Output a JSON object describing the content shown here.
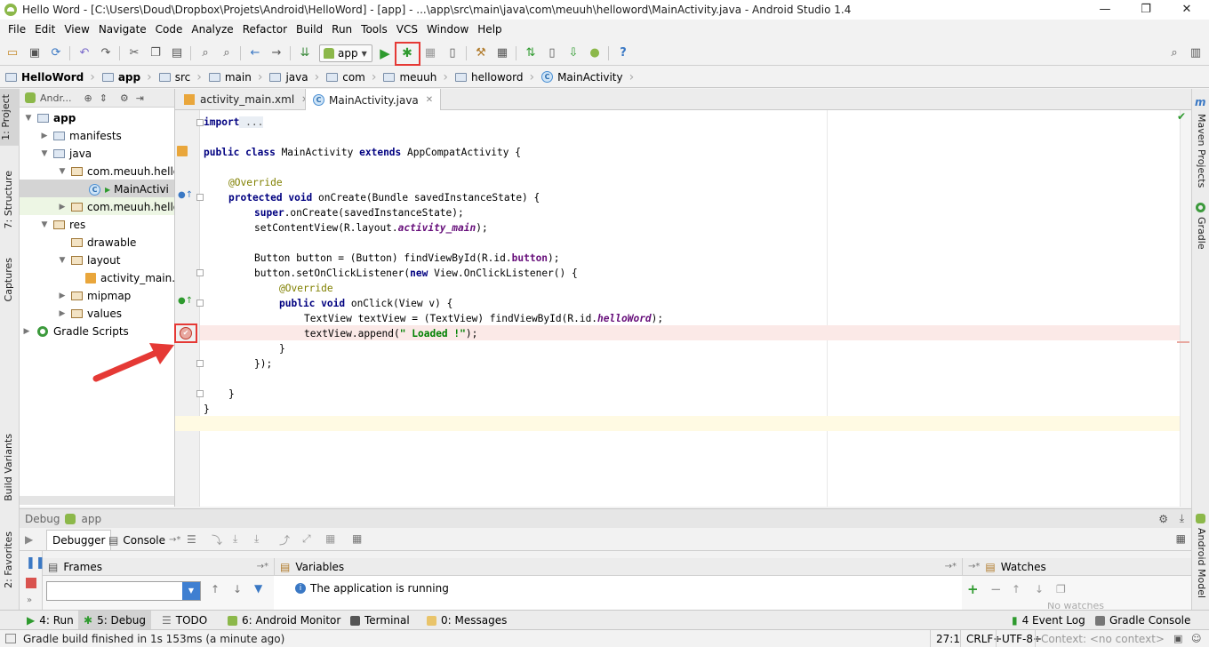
{
  "window": {
    "title": "Hello Word - [C:\\Users\\Doud\\Dropbox\\Projets\\Android\\HelloWord] - [app] - ...\\app\\src\\main\\java\\com\\meuuh\\helloword\\MainActivity.java - Android Studio 1.4",
    "minimize": "—",
    "maximize": "❐",
    "close": "✕"
  },
  "menu": [
    "File",
    "Edit",
    "View",
    "Navigate",
    "Code",
    "Analyze",
    "Refactor",
    "Build",
    "Run",
    "Tools",
    "VCS",
    "Window",
    "Help"
  ],
  "toolbar": {
    "run_config": "app"
  },
  "breadcrumb": [
    "HelloWord",
    "app",
    "src",
    "main",
    "java",
    "com",
    "meuuh",
    "helloword",
    "MainActivity"
  ],
  "left_tabs": [
    "1: Project",
    "7: Structure",
    "Captures",
    "Build Variants",
    "2: Favorites"
  ],
  "right_tabs": [
    "Maven Projects",
    "Gradle",
    "Android Model"
  ],
  "project": {
    "view_label": "Andr...",
    "tree": [
      {
        "label": "app",
        "depth": 0,
        "kind": "folder",
        "expanded": true
      },
      {
        "label": "manifests",
        "depth": 1,
        "kind": "folder",
        "expanded": false
      },
      {
        "label": "java",
        "depth": 1,
        "kind": "folder",
        "expanded": true
      },
      {
        "label": "com.meuuh.hello",
        "depth": 2,
        "kind": "folder",
        "expanded": true
      },
      {
        "label": "MainActivi",
        "depth": 3,
        "kind": "class",
        "selected": true
      },
      {
        "label": "com.meuuh.hello",
        "depth": 2,
        "kind": "folder",
        "expanded": false
      },
      {
        "label": "res",
        "depth": 1,
        "kind": "res",
        "expanded": true
      },
      {
        "label": "drawable",
        "depth": 2,
        "kind": "res",
        "expanded": null
      },
      {
        "label": "layout",
        "depth": 2,
        "kind": "res",
        "expanded": true
      },
      {
        "label": "activity_main.",
        "depth": 3,
        "kind": "xml"
      },
      {
        "label": "mipmap",
        "depth": 2,
        "kind": "res",
        "expanded": false
      },
      {
        "label": "values",
        "depth": 2,
        "kind": "res",
        "expanded": false
      },
      {
        "label": "Gradle Scripts",
        "depth": 0,
        "kind": "gradle",
        "expanded": false
      }
    ]
  },
  "editor": {
    "tabs": [
      {
        "label": "activity_main.xml",
        "active": false
      },
      {
        "label": "MainActivity.java",
        "active": true
      }
    ],
    "code": {
      "l1_kw": "import",
      "l1_fold": " ...",
      "l3_kw1": "public class ",
      "l3_name": "MainActivity ",
      "l3_kw2": "extends ",
      "l3_rest": "AppCompatActivity {",
      "l5_ann": "@Override",
      "l6_kw": "protected void ",
      "l6_rest": "onCreate(Bundle savedInstanceState) {",
      "l7_kw": "super",
      "l7_rest": ".onCreate(savedInstanceState);",
      "l8_a": "setContentView(R.layout.",
      "l8_b": "activity_main",
      "l8_c": ");",
      "l10_a": "Button button = (Button) findViewById(R.id.",
      "l10_b": "button",
      "l10_c": ");",
      "l11_a": "button.setOnClickListener(",
      "l11_kw": "new ",
      "l11_c": "View.OnClickListener() {",
      "l12_ann": "@Override",
      "l13_kw": "public void ",
      "l13_rest": "onClick(View v) {",
      "l14_a": "TextView textView = (TextView) findViewById(R.id.",
      "l14_b": "helloWord",
      "l14_c": ");",
      "l15_a": "textView.append(",
      "l15_str": "\" Loaded !\"",
      "l15_c": ");",
      "l16": "}",
      "l17": "});",
      "l19": "}",
      "l20": "}"
    }
  },
  "debug": {
    "title": "Debug",
    "config": "app",
    "tabs": [
      "Debugger",
      "Console"
    ],
    "frames_label": "Frames",
    "variables_label": "Variables",
    "watches_label": "Watches",
    "status_message": "The application is running",
    "no_watches": "No watches"
  },
  "bottom_tabs": [
    {
      "label": "4: Run",
      "active": false
    },
    {
      "label": "5: Debug",
      "active": true
    },
    {
      "label": "TODO",
      "active": false
    },
    {
      "label": "6: Android Monitor",
      "active": false
    },
    {
      "label": "Terminal",
      "active": false
    },
    {
      "label": "0: Messages",
      "active": false
    },
    {
      "label": "4 Event Log",
      "active": false
    },
    {
      "label": "Gradle Console",
      "active": false
    }
  ],
  "status": {
    "message": "Gradle build finished in 1s 153ms (a minute ago)",
    "position": "27:1",
    "line_sep": "CRLF÷",
    "encoding": "UTF-8÷",
    "context": "Context: <no context>"
  },
  "colors": {
    "highlight_red": "#e53935",
    "breakpoint_line": "#fbe9e7",
    "current_line": "#fffae3",
    "android_green": "#8cb84a"
  }
}
